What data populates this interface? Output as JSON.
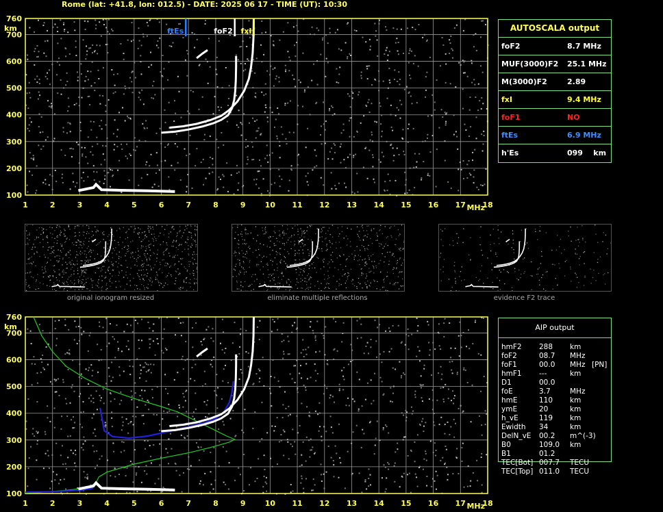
{
  "header": "Rome (lat: +41.8, lon: 012.5) - DATE: 2025 06 17 - TIME (UT): 10:30",
  "axes": {
    "y_unit": "km",
    "x_unit": "MHz",
    "y_ticks": [
      "100",
      "200",
      "300",
      "400",
      "500",
      "600",
      "700",
      "760"
    ],
    "x_ticks": [
      "1",
      "2",
      "3",
      "4",
      "5",
      "6",
      "7",
      "8",
      "9",
      "10",
      "11",
      "12",
      "13",
      "14",
      "15",
      "16",
      "17",
      "18"
    ]
  },
  "chart_data": [
    {
      "type": "scatter",
      "x": [
        1,
        18
      ],
      "ylim": [
        100,
        760
      ],
      "grid": true,
      "markers": [
        {
          "label": "ftEs",
          "x": 6.9,
          "color": "#2f7fff"
        },
        {
          "label": "foF2",
          "x": 8.7,
          "color": "#ffffff"
        },
        {
          "label": "fxI",
          "x": 9.4,
          "color": "#ffff33"
        }
      ],
      "series": [
        {
          "points": [
            [
              6.0,
              333
            ],
            [
              6.5,
              337
            ],
            [
              7.0,
              345
            ],
            [
              7.5,
              356
            ],
            [
              7.9,
              368
            ],
            [
              8.2,
              381
            ],
            [
              8.45,
              398
            ],
            [
              8.6,
              425
            ],
            [
              8.68,
              455
            ],
            [
              8.72,
              490
            ],
            [
              8.74,
              530
            ],
            [
              8.75,
              580
            ],
            [
              8.75,
              620
            ]
          ]
        },
        {
          "points": [
            [
              6.3,
              352
            ],
            [
              6.8,
              357
            ],
            [
              7.3,
              366
            ],
            [
              7.8,
              380
            ],
            [
              8.2,
              396
            ],
            [
              8.5,
              418
            ],
            [
              8.8,
              450
            ],
            [
              9.05,
              490
            ],
            [
              9.22,
              535
            ],
            [
              9.3,
              580
            ],
            [
              9.36,
              630
            ],
            [
              9.39,
              690
            ],
            [
              9.4,
              760
            ]
          ]
        },
        {
          "points": [
            [
              2.95,
              117
            ],
            [
              3.2,
              122
            ],
            [
              3.5,
              128
            ],
            [
              3.6,
              140
            ],
            [
              3.8,
              120
            ],
            [
              4.5,
              118
            ],
            [
              5.5,
              116
            ],
            [
              6.2,
              114
            ],
            [
              6.5,
              113
            ]
          ]
        },
        {
          "points": [
            [
              7.3,
              612
            ],
            [
              7.5,
              628
            ],
            [
              7.7,
              642
            ]
          ]
        }
      ]
    },
    {
      "type": "scatter",
      "x": [
        1,
        18
      ],
      "ylim": [
        100,
        760
      ],
      "grid": true,
      "series": [
        {
          "points": [
            [
              6.0,
              333
            ],
            [
              6.5,
              337
            ],
            [
              7.0,
              345
            ],
            [
              7.5,
              356
            ],
            [
              7.9,
              368
            ],
            [
              8.2,
              381
            ],
            [
              8.45,
              398
            ],
            [
              8.6,
              425
            ],
            [
              8.68,
              455
            ],
            [
              8.72,
              490
            ],
            [
              8.74,
              530
            ],
            [
              8.75,
              580
            ],
            [
              8.75,
              620
            ]
          ]
        },
        {
          "points": [
            [
              6.3,
              352
            ],
            [
              6.8,
              357
            ],
            [
              7.3,
              366
            ],
            [
              7.8,
              380
            ],
            [
              8.2,
              396
            ],
            [
              8.5,
              418
            ],
            [
              8.8,
              450
            ],
            [
              9.05,
              490
            ],
            [
              9.22,
              535
            ],
            [
              9.3,
              580
            ],
            [
              9.36,
              630
            ],
            [
              9.39,
              690
            ],
            [
              9.4,
              760
            ]
          ]
        },
        {
          "points": [
            [
              2.95,
              117
            ],
            [
              3.2,
              122
            ],
            [
              3.5,
              128
            ],
            [
              3.6,
              140
            ],
            [
              3.8,
              120
            ],
            [
              4.5,
              118
            ],
            [
              5.5,
              116
            ],
            [
              6.2,
              114
            ],
            [
              6.5,
              113
            ]
          ]
        },
        {
          "points": [
            [
              7.3,
              612
            ],
            [
              7.5,
              628
            ],
            [
              7.7,
              642
            ]
          ]
        }
      ],
      "lines": [
        {
          "color": "#22cc22",
          "points": [
            [
              1.3,
              760
            ],
            [
              1.6,
              690
            ],
            [
              2.0,
              630
            ],
            [
              2.5,
              575
            ],
            [
              3.2,
              530
            ],
            [
              4.0,
              490
            ],
            [
              5.0,
              455
            ],
            [
              6.0,
              425
            ],
            [
              6.6,
              405
            ],
            [
              7.2,
              375
            ],
            [
              8.0,
              335
            ],
            [
              8.4,
              315
            ],
            [
              8.7,
              302
            ],
            [
              8.5,
              292
            ],
            [
              7.8,
              272
            ],
            [
              7.0,
              252
            ],
            [
              6.0,
              232
            ],
            [
              5.0,
              210
            ],
            [
              4.0,
              180
            ],
            [
              3.7,
              162
            ],
            [
              3.6,
              140
            ],
            [
              3.3,
              122
            ],
            [
              2.5,
              112
            ],
            [
              1.5,
              104
            ],
            [
              1.0,
              102
            ]
          ]
        },
        {
          "color": "#2222dd",
          "points": [
            [
              3.75,
              420
            ],
            [
              3.9,
              335
            ],
            [
              4.2,
              313
            ],
            [
              4.8,
              307
            ],
            [
              5.5,
              315
            ],
            [
              6.2,
              330
            ],
            [
              7.0,
              350
            ],
            [
              7.6,
              365
            ],
            [
              8.0,
              380
            ],
            [
              8.3,
              405
            ],
            [
              8.5,
              440
            ],
            [
              8.6,
              480
            ],
            [
              8.65,
              520
            ]
          ]
        },
        {
          "color": "#2222dd",
          "points": [
            [
              1.0,
              105
            ],
            [
              2.0,
              107
            ],
            [
              3.0,
              112
            ],
            [
              3.5,
              120
            ]
          ]
        }
      ]
    }
  ],
  "thumbnails": {
    "captions": [
      "original ionogram resized",
      "eliminate multiple reflections",
      "evidence F2 trace"
    ]
  },
  "autoscala": {
    "title": "AUTOSCALA output",
    "rows": [
      {
        "label": "foF2",
        "value": "8.7 MHz",
        "color": "#ffffff"
      },
      {
        "label": "MUF(3000)F2",
        "value": "25.1 MHz",
        "color": "#ffffff"
      },
      {
        "label": "M(3000)F2",
        "value": "2.89",
        "color": "#ffffff"
      },
      {
        "label": "fxI",
        "value": "9.4 MHz",
        "color": "#ffff33"
      },
      {
        "label": "foF1",
        "value": "NO",
        "color": "#ff2222"
      },
      {
        "label": "ftEs",
        "value": "6.9 MHz",
        "color": "#3f8fff"
      },
      {
        "label": "h'Es",
        "value": "099    km",
        "color": "#ffffff"
      }
    ]
  },
  "aip": {
    "title": "AIP output",
    "rows": [
      {
        "label": "hmF2",
        "value": "288",
        "unit": "km",
        "extra": ""
      },
      {
        "label": "foF2",
        "value": "08.7",
        "unit": "MHz",
        "extra": ""
      },
      {
        "label": "foF1",
        "value": "00.0",
        "unit": "MHz",
        "extra": "[PN]"
      },
      {
        "label": "hmF1",
        "value": "---",
        "unit": "km",
        "extra": ""
      },
      {
        "label": "D1",
        "value": "00.0",
        "unit": "",
        "extra": ""
      },
      {
        "label": "foE",
        "value": "3.7",
        "unit": "MHz",
        "extra": ""
      },
      {
        "label": "hmE",
        "value": "110",
        "unit": "km",
        "extra": ""
      },
      {
        "label": "ymE",
        "value": "20",
        "unit": "km",
        "extra": ""
      },
      {
        "label": "h_vE",
        "value": "119",
        "unit": "km",
        "extra": ""
      },
      {
        "label": "Ewidth",
        "value": "34",
        "unit": "km",
        "extra": ""
      },
      {
        "label": "DelN_vE",
        "value": "00.2",
        "unit": "m^(-3)",
        "extra": ""
      },
      {
        "label": "B0",
        "value": "109.0",
        "unit": "km",
        "extra": ""
      },
      {
        "label": "B1",
        "value": "01.2",
        "unit": "",
        "extra": ""
      },
      {
        "label": "TEC[Bot]",
        "value": "007.7",
        "unit": "TECU",
        "extra": ""
      },
      {
        "label": "TEC[Top]",
        "value": "011.0",
        "unit": "TECU",
        "extra": ""
      }
    ]
  }
}
